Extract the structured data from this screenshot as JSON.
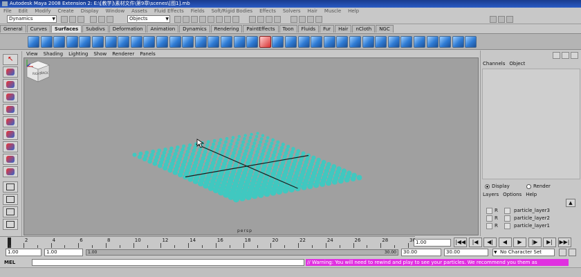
{
  "window": {
    "title": "Autodesk Maya 2008 Extension 2: E:\\[教学]\\素材文件\\第9章\\scenes\\[图1].mb",
    "watermark": "优酷"
  },
  "menubar": [
    "File",
    "Edit",
    "Modify",
    "Create",
    "Display",
    "Window",
    "Assets",
    "Fluid Effects",
    "Fields",
    "Soft/Rigid Bodies",
    "Effects",
    "Solvers",
    "Hair",
    "Muscle",
    "Help"
  ],
  "statusline": {
    "mode": "Dynamics",
    "selection_field": "Objects"
  },
  "shelf": {
    "tabs": [
      "General",
      "Curves",
      "Surfaces",
      "Subdivs",
      "Deformation",
      "Animation",
      "Dynamics",
      "Rendering",
      "PaintEffects",
      "Toon",
      "Fluids",
      "Fur",
      "Hair",
      "nCloth",
      "NGC"
    ],
    "active_tab": "Surfaces"
  },
  "panel_menu": [
    "View",
    "Shading",
    "Lighting",
    "Show",
    "Renderer",
    "Panels"
  ],
  "viewport": {
    "camera": "persp",
    "viewcube": {
      "front": "RIGHT",
      "side": "BACK"
    },
    "grid_color": "#40c8c0",
    "bg_color": "#a0a0a0"
  },
  "channel_box": {
    "menu": [
      "Channels",
      "Object"
    ]
  },
  "layer_editor": {
    "display_label": "Display",
    "render_label": "Render",
    "selected_mode": "Display",
    "menu": [
      "Layers",
      "Options",
      "Help"
    ],
    "layers": [
      {
        "r": "R",
        "name": "particle_layer3"
      },
      {
        "r": "R",
        "name": "particle_layer2"
      },
      {
        "r": "R",
        "name": "particle_layer1"
      }
    ]
  },
  "timeline": {
    "ticks": [
      "2",
      "4",
      "6",
      "8",
      "10",
      "12",
      "14",
      "16",
      "18",
      "20",
      "22",
      "24",
      "26",
      "28",
      "30"
    ],
    "start": 1,
    "end": 30,
    "current": "1.00"
  },
  "range": {
    "start_time": "1.00",
    "playback_start": "1.00",
    "playback_end": "30.00",
    "end_time": "30.00",
    "bar_start": "1.00",
    "bar_end": "30.00",
    "character_set": "No Character Set"
  },
  "playback_buttons": [
    "|◀◀",
    "|◀",
    "◀|",
    "◀",
    "▶",
    "|▶",
    "▶|",
    "▶▶|"
  ],
  "command_line": {
    "mel_label": "MEL",
    "warning": "// Warning: You will need to rewind and play to see your particles. We recommend you them as"
  }
}
